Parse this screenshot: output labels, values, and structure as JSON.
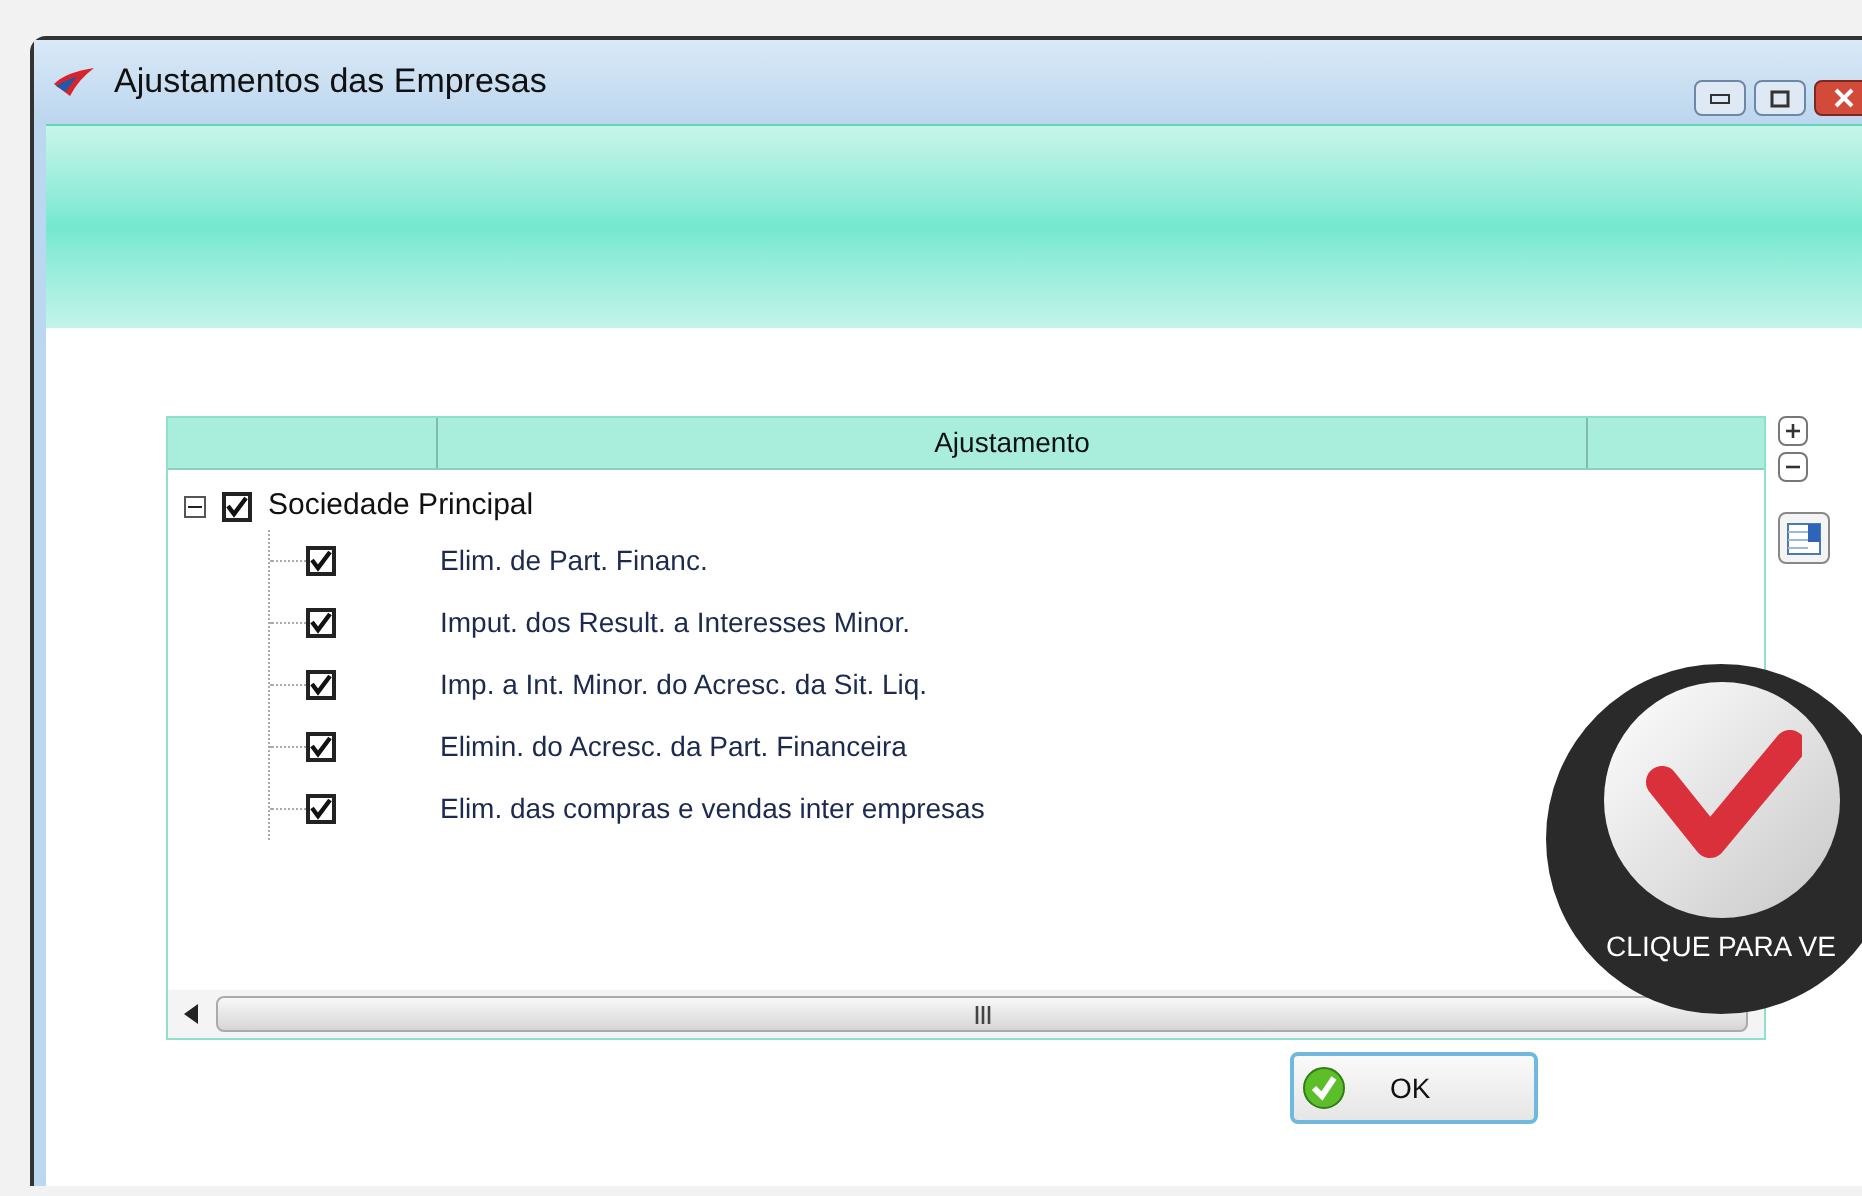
{
  "window": {
    "title": "Ajustamentos das Empresas"
  },
  "grid": {
    "column_header": "Ajustamento",
    "tree": [
      {
        "label": "Sociedade Principal",
        "checked": true,
        "expanded": true,
        "children": [
          {
            "label": "Elim. de Part. Financ.",
            "checked": true
          },
          {
            "label": "Imput. dos Result. a Interesses Minor.",
            "checked": true
          },
          {
            "label": "Imp. a Int. Minor. do Acresc. da Sit. Liq.",
            "checked": true
          },
          {
            "label": "Elimin. do Acresc. da Part. Financeira",
            "checked": true
          },
          {
            "label": "Elim. das compras e vendas inter empresas",
            "checked": true
          }
        ]
      }
    ],
    "side_buttons": [
      {
        "kind": "plus"
      },
      {
        "kind": "minus"
      },
      {
        "kind": "columns"
      }
    ]
  },
  "buttons": [
    {
      "label": "OK"
    }
  ],
  "overlay": {
    "caption": "CLIQUE PARA VE"
  }
}
